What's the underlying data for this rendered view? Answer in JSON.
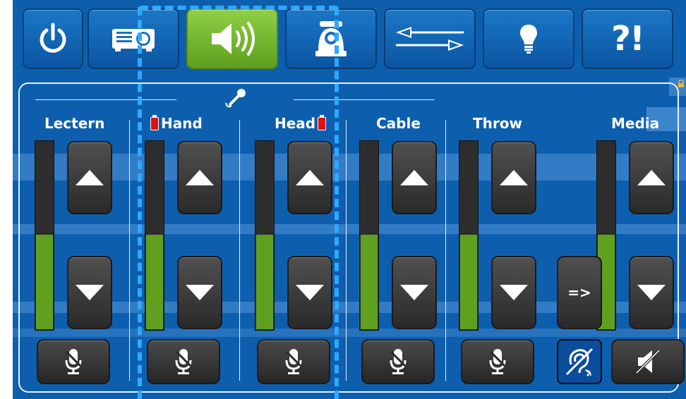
{
  "nav": {
    "buttons": [
      {
        "name": "power",
        "icon": "power-icon",
        "active": false
      },
      {
        "name": "projector",
        "icon": "projector-icon",
        "active": false
      },
      {
        "name": "audio",
        "icon": "speaker-icon",
        "active": true
      },
      {
        "name": "camera",
        "icon": "camera-icon",
        "active": false
      },
      {
        "name": "routing",
        "icon": "swap-arrows-icon",
        "active": false
      },
      {
        "name": "lighting",
        "icon": "lightbulb-icon",
        "active": false
      },
      {
        "name": "help",
        "label": "?!",
        "active": false
      }
    ]
  },
  "channels": [
    {
      "name": "Lectern",
      "battery_low": false,
      "level": 0.5
    },
    {
      "name": "Hand",
      "battery_low": true,
      "battery_position": "before",
      "level": 0.5
    },
    {
      "name": "Head",
      "battery_low": true,
      "battery_position": "after",
      "level": 0.5
    },
    {
      "name": "Cable",
      "battery_low": false,
      "level": 0.5
    },
    {
      "name": "Throw",
      "battery_low": false,
      "level": 0.5
    },
    {
      "name": "Media",
      "battery_low": false,
      "level": 0.5
    }
  ],
  "throw_route_label": "=>",
  "icons": {
    "wireless_mic": "wireless-microphone-icon",
    "mute": "microphone-mute-icon",
    "hearing_loop": "hearing-loop-icon",
    "speaker_mute": "speaker-mute-icon",
    "lock": "lock-icon"
  },
  "colors": {
    "background": "#0d5fae",
    "active_tab": "#7cc23a",
    "meter_fill": "#5fa11e",
    "battery_low": "#e01010",
    "dash_overlay": "#2fa8ff"
  }
}
